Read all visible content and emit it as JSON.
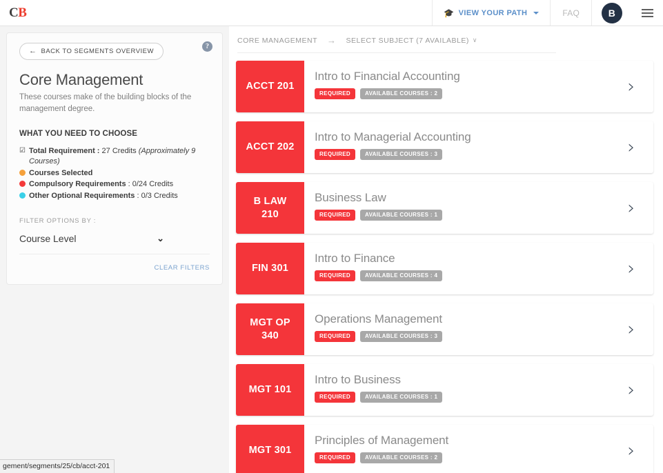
{
  "topnav": {
    "brand": {
      "first": "C",
      "second": "B"
    },
    "view_path_label": "VIEW YOUR PATH",
    "view_path_icon": "graduation-cap-icon",
    "faq_label": "FAQ",
    "avatar_initial": "B",
    "menu_icon": "hamburger-icon"
  },
  "sidebar": {
    "help_icon_glyph": "?",
    "back_button_label": "BACK TO SEGMENTS OVERVIEW",
    "back_button_arrow": "←",
    "segment_title": "Core Management",
    "segment_description": "These courses make of the building blocks of the management degree.",
    "choose_heading": "WHAT YOU NEED TO CHOOSE",
    "requirements": [
      {
        "marker": "checkbox",
        "marker_glyph": "☑",
        "color": "#3c3c3c",
        "label": "Total Requirement : ",
        "label_bold": "Total Requirement :",
        "value": "27 Credits",
        "note": "(Approximately 9 Courses)"
      },
      {
        "marker": "dot",
        "color": "#f5a13c",
        "label_bold": "Courses Selected",
        "value": "",
        "note": ""
      },
      {
        "marker": "dot",
        "color": "#f43a3a",
        "label_bold": "Compulsory Requirements",
        "value": " : 0/24 Credits",
        "note": ""
      },
      {
        "marker": "dot",
        "color": "#3ad0e8",
        "label_bold": "Other Optional Requirements",
        "value": " : 0/3 Credits",
        "note": ""
      }
    ],
    "filter_label": "FILTER OPTIONS BY :",
    "filter_selected": "Course Level",
    "filter_caret_glyph": "⌄",
    "clear_filters_label": "CLEAR FILTERS"
  },
  "main": {
    "breadcrumb": {
      "segment": "CORE MANAGEMENT",
      "arrow": "→",
      "subject": "SELECT SUBJECT (7 AVAILABLE)",
      "subject_caret": "∨"
    },
    "courses": [
      {
        "code": "ACCT 201",
        "title": "Intro to Financial Accounting",
        "required_badge": "REQUIRED",
        "available_badge": "AVAILABLE COURSES : 2",
        "chevron": "›"
      },
      {
        "code": "ACCT 202",
        "title": "Intro to Managerial Accounting",
        "required_badge": "REQUIRED",
        "available_badge": "AVAILABLE COURSES : 3",
        "chevron": "›"
      },
      {
        "code": "B LAW 210",
        "title": "Business Law",
        "required_badge": "REQUIRED",
        "available_badge": "AVAILABLE COURSES : 1",
        "chevron": "›"
      },
      {
        "code": "FIN 301",
        "title": "Intro to Finance",
        "required_badge": "REQUIRED",
        "available_badge": "AVAILABLE COURSES : 4",
        "chevron": "›"
      },
      {
        "code": "MGT OP 340",
        "title": "Operations Management",
        "required_badge": "REQUIRED",
        "available_badge": "AVAILABLE COURSES : 3",
        "chevron": "›"
      },
      {
        "code": "MGT 101",
        "title": "Intro to Business",
        "required_badge": "REQUIRED",
        "available_badge": "AVAILABLE COURSES : 1",
        "chevron": "›"
      },
      {
        "code": "MGT 301",
        "title": "Principles of Management",
        "required_badge": "REQUIRED",
        "available_badge": "AVAILABLE COURSES : 2",
        "chevron": "›"
      }
    ]
  },
  "statusbar": {
    "url": "gement/segments/25/cb/acct-201"
  },
  "colors": {
    "accent_red": "#f4353a",
    "brand_red": "#ec3c2d",
    "link_blue": "#5b8fc9",
    "selected_orange": "#f5a13c",
    "compulsory_red": "#f43a3a",
    "optional_cyan": "#3ad0e8",
    "avatar_navy": "#233145",
    "badge_grey": "#a8a8a8"
  }
}
